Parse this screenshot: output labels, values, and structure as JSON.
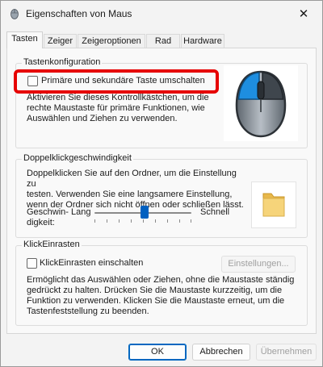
{
  "window": {
    "title": "Eigenschaften von Maus",
    "close_glyph": "✕"
  },
  "tabs": [
    {
      "label": "Tasten",
      "active": true
    },
    {
      "label": "Zeiger",
      "active": false
    },
    {
      "label": "Zeigeroptionen",
      "active": false
    },
    {
      "label": "Rad",
      "active": false
    },
    {
      "label": "Hardware",
      "active": false
    }
  ],
  "button_config": {
    "group_label": "Tastenkonfiguration",
    "checkbox_label": "Primäre und sekundäre Taste umschalten",
    "checked": false,
    "description_lines": [
      "Aktivieren Sie dieses Kontrollkästchen, um die",
      "rechte Maustaste für primäre Funktionen, wie",
      "Auswählen und Ziehen zu verwenden."
    ],
    "image_icon": "mouse-icon"
  },
  "double_click": {
    "group_label": "Doppelklickgeschwindigkeit",
    "description_lines": [
      "Doppelklicken Sie auf den Ordner, um die Einstellung zu",
      "testen. Verwenden Sie eine langsamere Einstellung,",
      "wenn der Ordner sich nicht öffnen oder schließen lässt."
    ],
    "speed_label_line1": "Geschwin-",
    "speed_label_line2": "digkeit:",
    "slow_label": "Lang",
    "fast_label": "Schnell",
    "slider_level": 0.5,
    "image_icon": "folder-icon"
  },
  "clicklock": {
    "group_label": "KlickEinrasten",
    "checkbox_label": "KlickEinrasten einschalten",
    "checked": false,
    "settings_button": "Einstellungen...",
    "description_lines": [
      "Ermöglicht das Auswählen oder Ziehen, ohne die Maustaste ständig",
      "gedrückt zu halten. Drücken Sie die Maustaste kurzzeitig, um die",
      "Funktion zu verwenden. Klicken Sie die Maustaste erneut, um die",
      "Tastenfeststellung zu beenden."
    ]
  },
  "footer": {
    "ok": "OK",
    "cancel": "Abbrechen",
    "apply": "Übernehmen"
  },
  "colors": {
    "highlight": "#e60000",
    "accent": "#0067c0"
  }
}
